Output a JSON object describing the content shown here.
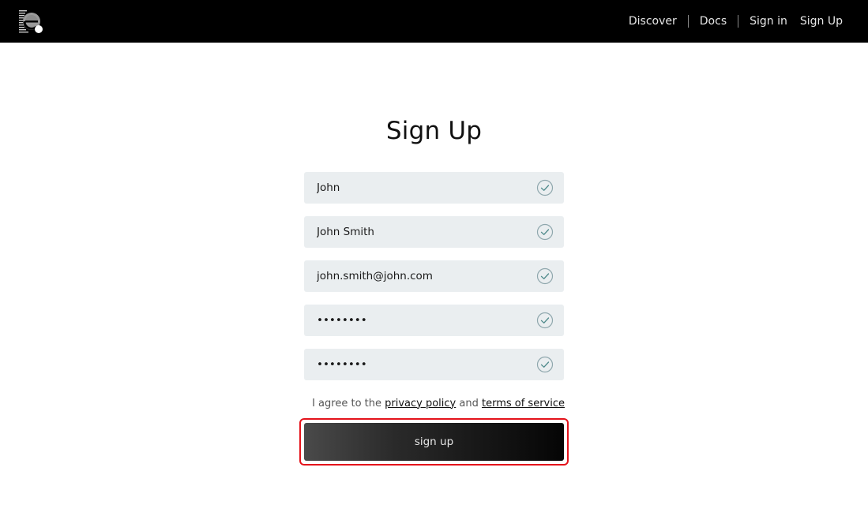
{
  "header": {
    "logo_icon": "e-logo-icon",
    "nav": {
      "discover": "Discover",
      "docs": "Docs",
      "sign_in": "Sign in",
      "sign_up": "Sign Up"
    }
  },
  "form": {
    "title": "Sign Up",
    "fields": [
      {
        "name": "first-name",
        "type": "text",
        "value": "John",
        "valid": true
      },
      {
        "name": "full-name",
        "type": "text",
        "value": "John Smith",
        "valid": true
      },
      {
        "name": "email",
        "type": "text",
        "value": "john.smith@john.com",
        "valid": true
      },
      {
        "name": "password",
        "type": "password",
        "value": "••••••••",
        "valid": true
      },
      {
        "name": "confirm-password",
        "type": "password",
        "value": "••••••••",
        "valid": true
      }
    ],
    "agree": {
      "checked": true,
      "prefix": "I agree to the ",
      "privacy_link": "privacy policy",
      "middle": " and ",
      "terms_link": "terms of service"
    },
    "submit_label": "sign up"
  },
  "colors": {
    "topbar": "#000000",
    "field_bg": "#eaeef0",
    "check_teal": "#4f8a8b",
    "highlight_red": "#e4131b"
  }
}
